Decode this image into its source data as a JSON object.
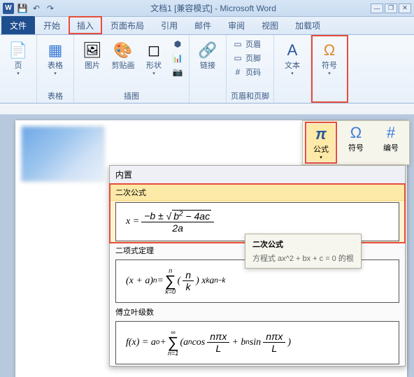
{
  "titlebar": {
    "title": "文档1 [兼容模式] - Microsoft Word",
    "qat": {
      "save": "💾",
      "undo": "↶",
      "redo": "↷"
    },
    "win": {
      "min": "—",
      "restore": "❐",
      "help": "?",
      "close": "✕"
    }
  },
  "tabs": {
    "file": "文件",
    "home": "开始",
    "insert": "插入",
    "layout": "页面布局",
    "references": "引用",
    "mailings": "邮件",
    "review": "审阅",
    "view": "视图",
    "addins": "加载项"
  },
  "ribbon": {
    "pages": {
      "label": "页",
      "coverpage": "页"
    },
    "tables": {
      "label": "表格",
      "btn": "表格"
    },
    "illustrations": {
      "label": "插图",
      "picture": "图片",
      "clipart": "剪贴画",
      "shapes": "形状",
      "smartart": "",
      "chart": ""
    },
    "links": {
      "label": "",
      "hyperlink": "链接"
    },
    "headerfooter": {
      "label": "页眉和页脚",
      "header": "页眉",
      "footer": "页脚",
      "pagenum": "页码"
    },
    "text": {
      "label": "",
      "textbox": "文本"
    },
    "symbols": {
      "label": "",
      "symbol": "符号"
    }
  },
  "float_ribbon": {
    "equation": "公式",
    "symbol": "符号",
    "number": "编号"
  },
  "equation_dropdown": {
    "header": "内置",
    "items": [
      {
        "title": "二次公式",
        "formula_tex": "x = (-b ± √(b²-4ac)) / 2a"
      },
      {
        "title": "二项式定理",
        "formula_tex": "(x+a)^n = Σ_{k=0}^{n} C(n,k) x^k a^{n-k}"
      },
      {
        "title": "傅立叶级数",
        "formula_tex": "f(x) = a₀ + Σ_{n=1}^{∞} (aₙ cos(nπx/L) + bₙ sin(nπx/L))"
      }
    ]
  },
  "tooltip": {
    "title": "二次公式",
    "desc": "方程式 ax^2 + bx + c = 0 的根"
  },
  "colors": {
    "highlight_border": "#e74c3c",
    "highlight_fill": "#fde9a8"
  }
}
